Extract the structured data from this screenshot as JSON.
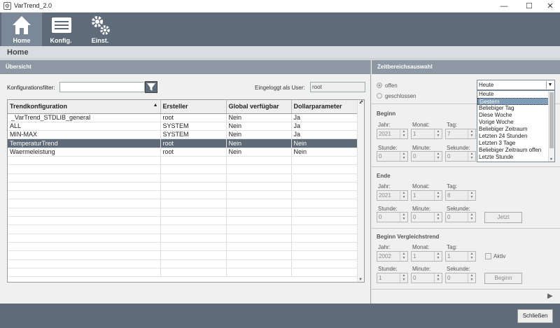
{
  "window": {
    "title": "VarTrend_2.0",
    "minimize": "—",
    "maximize": "☐",
    "close": "✕"
  },
  "toolbar": {
    "home": "Home",
    "config": "Konfig.",
    "settings": "Einst."
  },
  "breadcrumb": "Home",
  "overview": {
    "title": "Übersicht",
    "filter_label": "Konfigurationsfilter:",
    "filter_value": "",
    "logged_in_label": "Eingeloggt als User:",
    "user": "root",
    "columns": [
      "Trendkonfiguration",
      "Ersteller",
      "Global verfügbar",
      "Dollarparameter"
    ],
    "rows": [
      [
        "_VarTrend_STDLIB_general",
        "root",
        "Nein",
        "Ja"
      ],
      [
        "ALL",
        "SYSTEM",
        "Nein",
        "Ja"
      ],
      [
        "MIN-MAX",
        "SYSTEM",
        "Nein",
        "Ja"
      ],
      [
        "TemperaturTrend",
        "root",
        "Nein",
        "Nein"
      ],
      [
        "Waermeleistung",
        "root",
        "Nein",
        "Nein"
      ]
    ],
    "selected_row": 3
  },
  "timerange": {
    "title": "Zeitbereichsauswahl",
    "radio_open": "offen",
    "radio_closed": "geschlossen",
    "combo_value": "Heute",
    "options": [
      "Heute",
      "Gestern",
      "Beliebiger Tag",
      "Diese Woche",
      "Vorige Woche",
      "Beliebiger Zeitraum",
      "Letzten 24 Stunden",
      "Letzten 3 Tage",
      "Beliebiger Zeitraum offen",
      "Letzte Stunde"
    ],
    "highlighted": 1,
    "begin": {
      "title": "Beginn",
      "year_label": "Jahr:",
      "month_label": "Monat:",
      "day_label": "Tag:",
      "hour_label": "Stunde:",
      "minute_label": "Minute:",
      "second_label": "Sekunde:",
      "year": "2021",
      "month": "1",
      "day": "7",
      "hour": "0",
      "minute": "0",
      "second": "0"
    },
    "end": {
      "title": "Ende",
      "year_label": "Jahr:",
      "month_label": "Monat:",
      "day_label": "Tag:",
      "hour_label": "Stunde:",
      "minute_label": "Minute:",
      "second_label": "Sekunde:",
      "year": "2021",
      "month": "1",
      "day": "8",
      "hour": "0",
      "minute": "0",
      "second": "0",
      "now_button": "Jetzt"
    },
    "compare": {
      "title": "Beginn Vergleichstrend",
      "year_label": "Jahr:",
      "month_label": "Monat:",
      "day_label": "Tag:",
      "hour_label": "Stunde:",
      "minute_label": "Minute:",
      "second_label": "Sekunde:",
      "year": "2002",
      "month": "1",
      "day": "1",
      "hour": "1",
      "minute": "0",
      "second": "0",
      "active_label": "Aktiv",
      "begin_button": "Beginn"
    }
  },
  "footer": {
    "close_button": "Schließen"
  }
}
